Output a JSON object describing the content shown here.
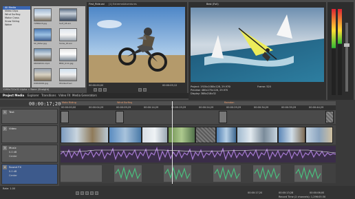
{
  "explorer": {
    "tree_items": [
      "All Media",
      "Video Clips",
      "Wind Surfing",
      "Motor Cross",
      "Snow Skiing",
      "Water"
    ],
    "selected_index": 0,
    "thumbs": [
      {
        "label": "7286123.jpg"
      },
      {
        "label": "Surf_03.avi"
      },
      {
        "label": "SC_Rider.jpg"
      },
      {
        "label": "Snow_22.avi"
      },
      {
        "label": "06042021.mp4"
      },
      {
        "label": "BMX_trick.jpg"
      },
      {
        "label": "04014000.jpg"
      },
      {
        "label": "Windsurf.avi"
      }
    ],
    "info": "1280x720x32 Alpha = None (Straight)"
  },
  "trimmer": {
    "title": "First_Ride.avi",
    "subtitle": "[1] ExtremeAdventures",
    "timecode_left": "00:00:00;00",
    "timecode_right": "00:00:05;12"
  },
  "viewer": {
    "title": "Best (Full)",
    "info_lines": [
      "Project: 1920x1080x128, 29.970i",
      "Preview: 480x270x128, 29.970",
      "Display: 388x218x32"
    ],
    "frame": "Frame: 520"
  },
  "tabs": [
    "Project Media",
    "Explorer",
    "Transitions",
    "Video FX",
    "Media Generators"
  ],
  "active_tab": 0,
  "timeline": {
    "timecode": "00:00:17;20",
    "markers": [
      "Moto Riding",
      "Wind Surfing",
      "Ramdon"
    ],
    "ruler_ticks": [
      "00:00:00;00",
      "00:00:04;29",
      "00:00:09;29",
      "00:00:14;29",
      "00:00:19;29",
      "00:00:24;29",
      "00:00:29;29",
      "00:00:34;29",
      "00:00:39;29",
      "00:00:44;29"
    ],
    "tracks": [
      {
        "num": "1",
        "name": "Text",
        "type": "text"
      },
      {
        "num": "2",
        "name": "Video",
        "type": "video"
      },
      {
        "num": "3",
        "name": "Music",
        "type": "audio",
        "vol": "0.0 dB",
        "pan": "Center"
      },
      {
        "num": "4",
        "name": "Sound FX",
        "type": "audio",
        "vol": "0.0 dB",
        "pan": "Center"
      }
    ],
    "rate": "Rate: 1.00",
    "status_left": "00:00:17;20",
    "status_mid": "00:00:13;28",
    "status_right": "00:00:06;00",
    "record_time": "Record Time (2 channels): 1,296:05:30"
  },
  "colors": {
    "accent": "#3a66b3",
    "waveform": "#8a5ab8",
    "sfx_wave": "#3fae6f",
    "marker": "#e06030"
  }
}
